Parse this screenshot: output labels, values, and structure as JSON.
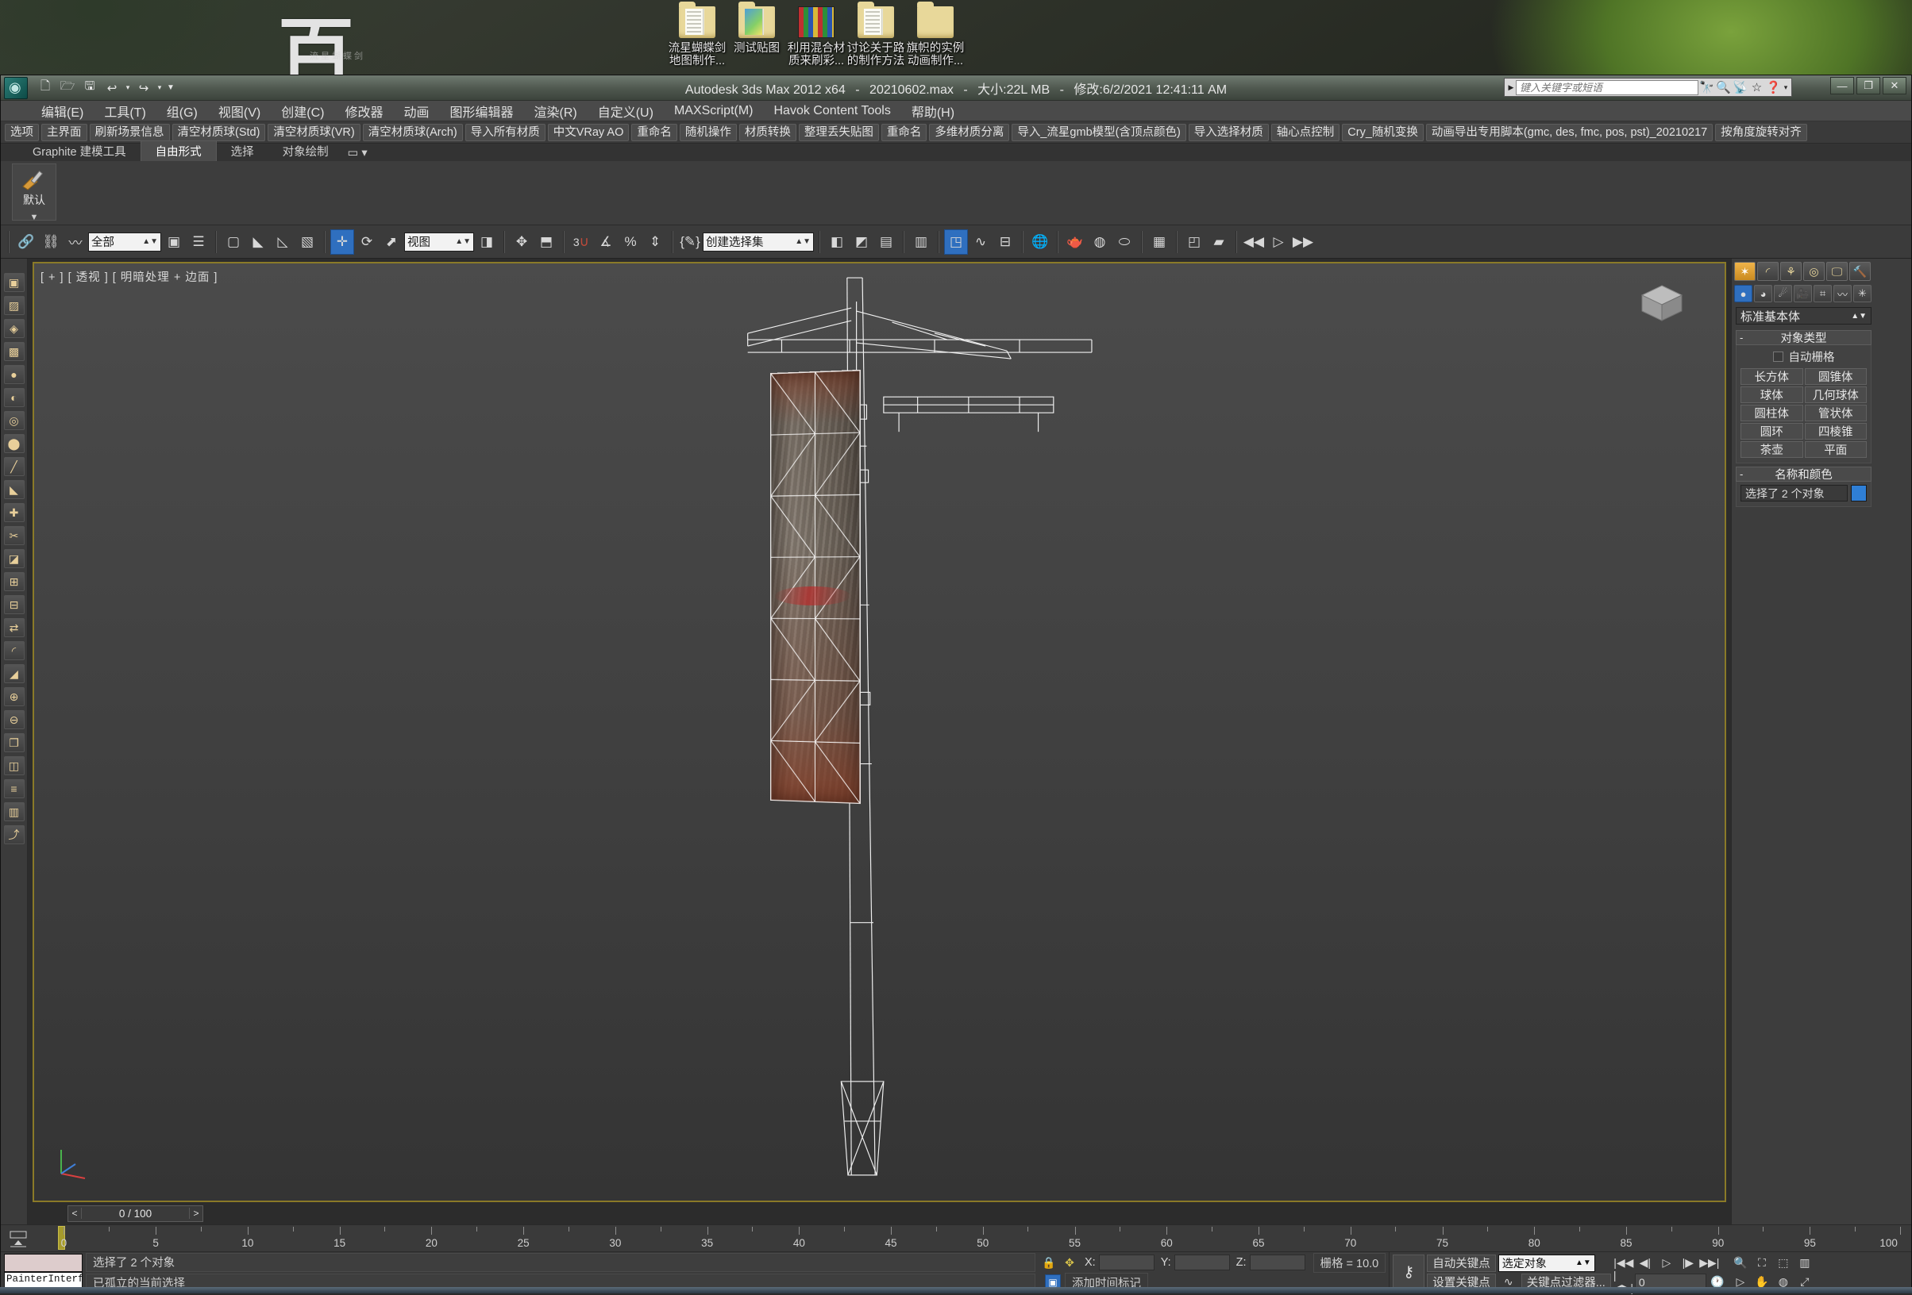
{
  "desktop": {
    "watermark": "百",
    "watermark_sub": "流星蝴蝶剑",
    "icons": [
      {
        "name": "流星蝴蝶剑地图制作...",
        "line1": "流星蝴蝶剑",
        "line2": "地图制作...",
        "type": "folder"
      },
      {
        "name": "测试贴图",
        "line1": "测试贴图",
        "line2": "",
        "type": "folder-pic"
      },
      {
        "name": "利用混合材质来刷彩...",
        "line1": "利用混合材",
        "line2": "质来刷彩...",
        "type": "image"
      },
      {
        "name": "讨论关于路的制作方法",
        "line1": "讨论关于路",
        "line2": "的制作方法",
        "type": "folder"
      },
      {
        "name": "旗帜的实例动画制作...",
        "line1": "旗帜的实例",
        "line2": "动画制作...",
        "type": "folder"
      }
    ]
  },
  "titlebar": {
    "app": "Autodesk 3ds Max  2012 x64",
    "file": "20210602.max",
    "size": "大小:22L MB",
    "modified": "修改:6/2/2021 12:41:11 AM",
    "sep": "-",
    "quick_access": [
      "new-icon",
      "open-icon",
      "save-icon",
      "undo-icon",
      "redo-icon",
      "chevron-down-icon"
    ],
    "search_placeholder": "键入关键字或短语",
    "search_value": "",
    "help_icons": [
      "binoculars-icon",
      "wrench-icon",
      "satellite-icon",
      "star-icon",
      "help-icon"
    ],
    "window_buttons": [
      "minimize",
      "maximize",
      "close"
    ]
  },
  "menubar": {
    "items": [
      "编辑(E)",
      "工具(T)",
      "组(G)",
      "视图(V)",
      "创建(C)",
      "修改器",
      "动画",
      "图形编辑器",
      "渲染(R)",
      "自定义(U)",
      "MAXScript(M)",
      "Havok Content Tools",
      "帮助(H)"
    ]
  },
  "scriptbar": {
    "buttons": [
      "选项",
      "主界面",
      "刷新场景信息",
      "清空材质球(Std)",
      "清空材质球(VR)",
      "清空材质球(Arch)",
      "导入所有材质",
      "中文VRay AO",
      "重命名",
      "随机操作",
      "材质转换",
      "整理丢失贴图",
      "重命名",
      "多维材质分离",
      "导入_流星gmb模型(含顶点颜色)",
      "导入选择材质",
      "轴心点控制",
      "Cry_随机变换",
      "动画导出专用脚本(gmc, des, fmc, pos, pst)_20210217",
      "按角度旋转对齐"
    ]
  },
  "graphite": {
    "tabs": [
      "Graphite 建模工具",
      "自由形式",
      "选择",
      "对象绘制"
    ],
    "active_tab": "自由形式",
    "panel_label": "默认",
    "overflow_icon": "dropdown-icon"
  },
  "maintoolbar": {
    "selection_filter": "全部",
    "coord_system": "视图",
    "named_selection": "创建选择集",
    "snap_degrees": "3",
    "active_transform": "move",
    "icons": [
      "select-link-icon",
      "unlink-icon",
      "bind-space-warp-icon",
      "select-object-icon",
      "select-by-name-icon",
      "rect-select-icon",
      "fence-select-icon",
      "lasso-select-icon",
      "paint-select-icon",
      "move-icon",
      "rotate-icon",
      "scale-icon",
      "use-pivot-icon",
      "use-center-icon",
      "align-icon",
      "snap-toggle-icon",
      "angle-snap-icon",
      "percent-snap-icon",
      "spinner-snap-icon",
      "edit-named-selection-icon",
      "mirror-icon",
      "align-tools-icon",
      "layer-manager-icon",
      "ribbon-icon",
      "curve-editor-icon",
      "schematic-view-icon",
      "material-editor-icon",
      "render-setup-icon",
      "render-frame-icon",
      "render-production-icon",
      "render-iterative-icon",
      "activeshade-icon",
      "undo-view-icon",
      "redo-view-icon"
    ]
  },
  "leftstrip": {
    "icons": [
      "poly-tools-icon",
      "texture-icon",
      "uv-icon",
      "map-icon",
      "material-icon",
      "bake-icon",
      "shape-icon",
      "vertex-icon",
      "edge-icon",
      "face-icon",
      "weld-icon",
      "cut-icon",
      "bevel-icon",
      "inset-icon",
      "bridge-icon",
      "flip-icon",
      "smooth-icon",
      "chamfer-icon",
      "attach-icon",
      "detach-icon",
      "clone-icon",
      "mirror-tool-icon",
      "align-tool-icon",
      "snapshot-icon",
      "export-icon"
    ]
  },
  "viewport": {
    "label": "[ + ] [ 透视 ] [ 明暗处理 + 边面 ]",
    "viewcube_label": "viewcube",
    "axis_gizmo": "axis-tripod",
    "time_slider": {
      "value": "0 / 100",
      "prev": "<",
      "next": ">"
    }
  },
  "command_panel": {
    "tabs": [
      "create-tab",
      "modify-tab",
      "hierarchy-tab",
      "motion-tab",
      "display-tab",
      "utilities-tab"
    ],
    "active_tab": "create-tab",
    "categories": [
      "geometry-icon",
      "shapes-icon",
      "lights-icon",
      "cameras-icon",
      "helpers-icon",
      "space-warps-icon",
      "systems-icon"
    ],
    "active_category": "geometry-icon",
    "subcategory": "标准基本体",
    "object_type": {
      "title": "对象类型",
      "autogrid_label": "自动栅格",
      "autogrid_checked": false,
      "buttons": [
        "长方体",
        "圆锥体",
        "球体",
        "几何球体",
        "圆柱体",
        "管状体",
        "圆环",
        "四棱锥",
        "茶壶",
        "平面"
      ]
    },
    "name_color": {
      "title": "名称和颜色",
      "name_value": "选择了 2 个对象",
      "color": "#2f7fd6"
    }
  },
  "trackbar": {
    "key_mode_icon": "key-mode-icon",
    "ruler_labels": [
      "0",
      "5",
      "10",
      "15",
      "20",
      "25",
      "30",
      "35",
      "40",
      "45",
      "50",
      "55",
      "60",
      "65",
      "70",
      "75",
      "80",
      "85",
      "90",
      "95",
      "100"
    ],
    "playhead_frame": "0"
  },
  "statusbar": {
    "listener_field": "PainterInterfa",
    "line1": "选择了 2 个对象",
    "line2": "已孤立的当前选择",
    "lock_icon": "lock-icon",
    "abs_rel_icon": "absolute-mode-icon",
    "coords": {
      "x_label": "X:",
      "x_value": "",
      "y_label": "Y:",
      "y_value": "",
      "z_label": "Z:",
      "z_value": ""
    },
    "grid": "栅格 = 10.0",
    "add_time_tag": "添加时间标记",
    "auto_key": "自动关键点",
    "set_key": "设置关键点",
    "key_filters": "关键点过滤器...",
    "selection_scope": "选定对象",
    "frame_value": "0",
    "key_icon": "key-icon",
    "playback_icons": [
      "goto-start-icon",
      "prev-frame-icon",
      "play-icon",
      "next-frame-icon",
      "goto-end-icon"
    ],
    "nav_icons": [
      "zoom-icon",
      "zoom-all-icon",
      "zoom-extents-icon",
      "zoom-extents-all-icon",
      "field-of-view-icon",
      "pan-icon",
      "orbit-icon",
      "maximize-viewport-icon"
    ],
    "key_nav": "key-nav-icon"
  }
}
